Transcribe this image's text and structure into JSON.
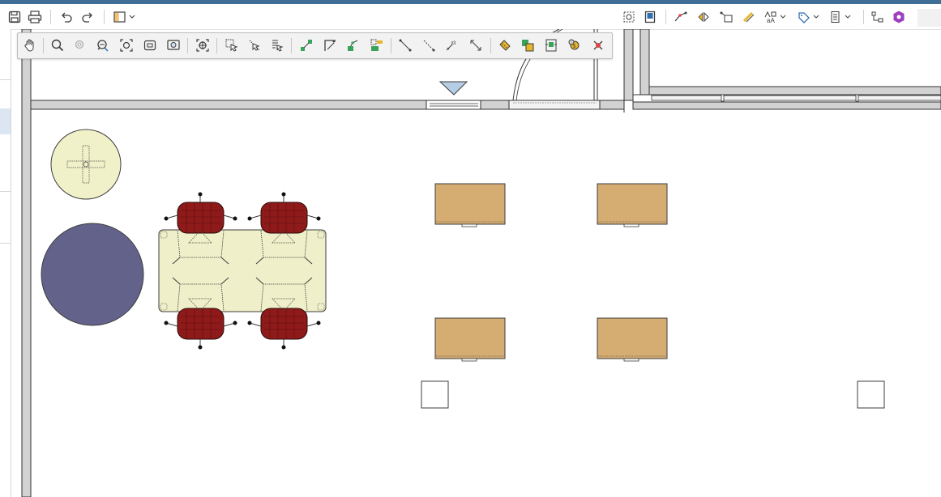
{
  "app": {
    "window_accent": "#3f6f97"
  },
  "toolbar": {
    "left_icons": [
      "save-icon",
      "print-icon",
      "undo-icon",
      "redo-icon",
      "layout-view-icon"
    ],
    "right_icons": [
      "select-objects-icon",
      "book-icon",
      "connect-points-icon",
      "flip-icon",
      "transform-icon",
      "pencil-ruler-icon",
      "text-style-icon",
      "tag-icon",
      "list-view-icon",
      "hierarchy-icon",
      "hexagon-plugin-icon"
    ]
  },
  "floating_toolbar": {
    "icons": [
      "pan-hand-icon",
      "zoom-icon",
      "zoom-out-icon",
      "zoom-window-icon",
      "zoom-extents-icon",
      "zoom-fit-icon",
      "zoom-previous-icon",
      "snap-center-icon",
      "select-region-icon",
      "deselect-icon",
      "select-properties-icon",
      "connect-icon",
      "snap-corner-icon",
      "edit-node-icon",
      "edit-group-icon",
      "line-tool-icon",
      "dashed-line-icon",
      "3d-line-icon",
      "dimension-icon",
      "measure-icon",
      "copy-object-icon",
      "replace-object-icon",
      "cost-icon",
      "delete-icon"
    ]
  },
  "floorplan": {
    "colors": {
      "wall": "#d2d2d2",
      "wall_outline": "#333333",
      "small_round_table": "#f1f1c9",
      "large_round_table": "#62628b",
      "conference_table": "#eff0c9",
      "chair": "#8e1a1a",
      "desk": "#d5ac72",
      "door_marker": "#b6cde6"
    }
  }
}
